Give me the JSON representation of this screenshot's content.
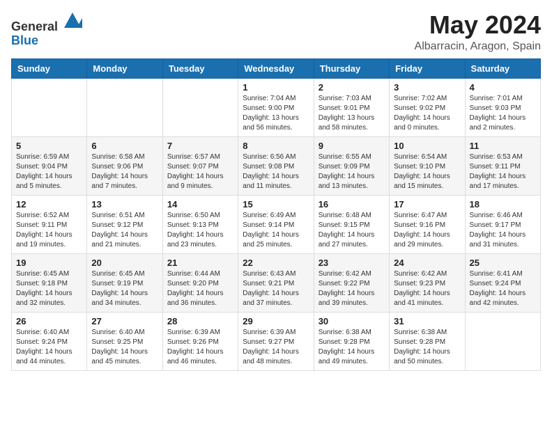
{
  "header": {
    "logo_general": "General",
    "logo_blue": "Blue",
    "title": "May 2024",
    "subtitle": "Albarracin, Aragon, Spain"
  },
  "days_of_week": [
    "Sunday",
    "Monday",
    "Tuesday",
    "Wednesday",
    "Thursday",
    "Friday",
    "Saturday"
  ],
  "weeks": [
    [
      {
        "day": "",
        "sunrise": "",
        "sunset": "",
        "daylight": ""
      },
      {
        "day": "",
        "sunrise": "",
        "sunset": "",
        "daylight": ""
      },
      {
        "day": "",
        "sunrise": "",
        "sunset": "",
        "daylight": ""
      },
      {
        "day": "1",
        "sunrise": "Sunrise: 7:04 AM",
        "sunset": "Sunset: 9:00 PM",
        "daylight": "Daylight: 13 hours and 56 minutes."
      },
      {
        "day": "2",
        "sunrise": "Sunrise: 7:03 AM",
        "sunset": "Sunset: 9:01 PM",
        "daylight": "Daylight: 13 hours and 58 minutes."
      },
      {
        "day": "3",
        "sunrise": "Sunrise: 7:02 AM",
        "sunset": "Sunset: 9:02 PM",
        "daylight": "Daylight: 14 hours and 0 minutes."
      },
      {
        "day": "4",
        "sunrise": "Sunrise: 7:01 AM",
        "sunset": "Sunset: 9:03 PM",
        "daylight": "Daylight: 14 hours and 2 minutes."
      }
    ],
    [
      {
        "day": "5",
        "sunrise": "Sunrise: 6:59 AM",
        "sunset": "Sunset: 9:04 PM",
        "daylight": "Daylight: 14 hours and 5 minutes."
      },
      {
        "day": "6",
        "sunrise": "Sunrise: 6:58 AM",
        "sunset": "Sunset: 9:06 PM",
        "daylight": "Daylight: 14 hours and 7 minutes."
      },
      {
        "day": "7",
        "sunrise": "Sunrise: 6:57 AM",
        "sunset": "Sunset: 9:07 PM",
        "daylight": "Daylight: 14 hours and 9 minutes."
      },
      {
        "day": "8",
        "sunrise": "Sunrise: 6:56 AM",
        "sunset": "Sunset: 9:08 PM",
        "daylight": "Daylight: 14 hours and 11 minutes."
      },
      {
        "day": "9",
        "sunrise": "Sunrise: 6:55 AM",
        "sunset": "Sunset: 9:09 PM",
        "daylight": "Daylight: 14 hours and 13 minutes."
      },
      {
        "day": "10",
        "sunrise": "Sunrise: 6:54 AM",
        "sunset": "Sunset: 9:10 PM",
        "daylight": "Daylight: 14 hours and 15 minutes."
      },
      {
        "day": "11",
        "sunrise": "Sunrise: 6:53 AM",
        "sunset": "Sunset: 9:11 PM",
        "daylight": "Daylight: 14 hours and 17 minutes."
      }
    ],
    [
      {
        "day": "12",
        "sunrise": "Sunrise: 6:52 AM",
        "sunset": "Sunset: 9:11 PM",
        "daylight": "Daylight: 14 hours and 19 minutes."
      },
      {
        "day": "13",
        "sunrise": "Sunrise: 6:51 AM",
        "sunset": "Sunset: 9:12 PM",
        "daylight": "Daylight: 14 hours and 21 minutes."
      },
      {
        "day": "14",
        "sunrise": "Sunrise: 6:50 AM",
        "sunset": "Sunset: 9:13 PM",
        "daylight": "Daylight: 14 hours and 23 minutes."
      },
      {
        "day": "15",
        "sunrise": "Sunrise: 6:49 AM",
        "sunset": "Sunset: 9:14 PM",
        "daylight": "Daylight: 14 hours and 25 minutes."
      },
      {
        "day": "16",
        "sunrise": "Sunrise: 6:48 AM",
        "sunset": "Sunset: 9:15 PM",
        "daylight": "Daylight: 14 hours and 27 minutes."
      },
      {
        "day": "17",
        "sunrise": "Sunrise: 6:47 AM",
        "sunset": "Sunset: 9:16 PM",
        "daylight": "Daylight: 14 hours and 29 minutes."
      },
      {
        "day": "18",
        "sunrise": "Sunrise: 6:46 AM",
        "sunset": "Sunset: 9:17 PM",
        "daylight": "Daylight: 14 hours and 31 minutes."
      }
    ],
    [
      {
        "day": "19",
        "sunrise": "Sunrise: 6:45 AM",
        "sunset": "Sunset: 9:18 PM",
        "daylight": "Daylight: 14 hours and 32 minutes."
      },
      {
        "day": "20",
        "sunrise": "Sunrise: 6:45 AM",
        "sunset": "Sunset: 9:19 PM",
        "daylight": "Daylight: 14 hours and 34 minutes."
      },
      {
        "day": "21",
        "sunrise": "Sunrise: 6:44 AM",
        "sunset": "Sunset: 9:20 PM",
        "daylight": "Daylight: 14 hours and 36 minutes."
      },
      {
        "day": "22",
        "sunrise": "Sunrise: 6:43 AM",
        "sunset": "Sunset: 9:21 PM",
        "daylight": "Daylight: 14 hours and 37 minutes."
      },
      {
        "day": "23",
        "sunrise": "Sunrise: 6:42 AM",
        "sunset": "Sunset: 9:22 PM",
        "daylight": "Daylight: 14 hours and 39 minutes."
      },
      {
        "day": "24",
        "sunrise": "Sunrise: 6:42 AM",
        "sunset": "Sunset: 9:23 PM",
        "daylight": "Daylight: 14 hours and 41 minutes."
      },
      {
        "day": "25",
        "sunrise": "Sunrise: 6:41 AM",
        "sunset": "Sunset: 9:24 PM",
        "daylight": "Daylight: 14 hours and 42 minutes."
      }
    ],
    [
      {
        "day": "26",
        "sunrise": "Sunrise: 6:40 AM",
        "sunset": "Sunset: 9:24 PM",
        "daylight": "Daylight: 14 hours and 44 minutes."
      },
      {
        "day": "27",
        "sunrise": "Sunrise: 6:40 AM",
        "sunset": "Sunset: 9:25 PM",
        "daylight": "Daylight: 14 hours and 45 minutes."
      },
      {
        "day": "28",
        "sunrise": "Sunrise: 6:39 AM",
        "sunset": "Sunset: 9:26 PM",
        "daylight": "Daylight: 14 hours and 46 minutes."
      },
      {
        "day": "29",
        "sunrise": "Sunrise: 6:39 AM",
        "sunset": "Sunset: 9:27 PM",
        "daylight": "Daylight: 14 hours and 48 minutes."
      },
      {
        "day": "30",
        "sunrise": "Sunrise: 6:38 AM",
        "sunset": "Sunset: 9:28 PM",
        "daylight": "Daylight: 14 hours and 49 minutes."
      },
      {
        "day": "31",
        "sunrise": "Sunrise: 6:38 AM",
        "sunset": "Sunset: 9:28 PM",
        "daylight": "Daylight: 14 hours and 50 minutes."
      },
      {
        "day": "",
        "sunrise": "",
        "sunset": "",
        "daylight": ""
      }
    ]
  ]
}
